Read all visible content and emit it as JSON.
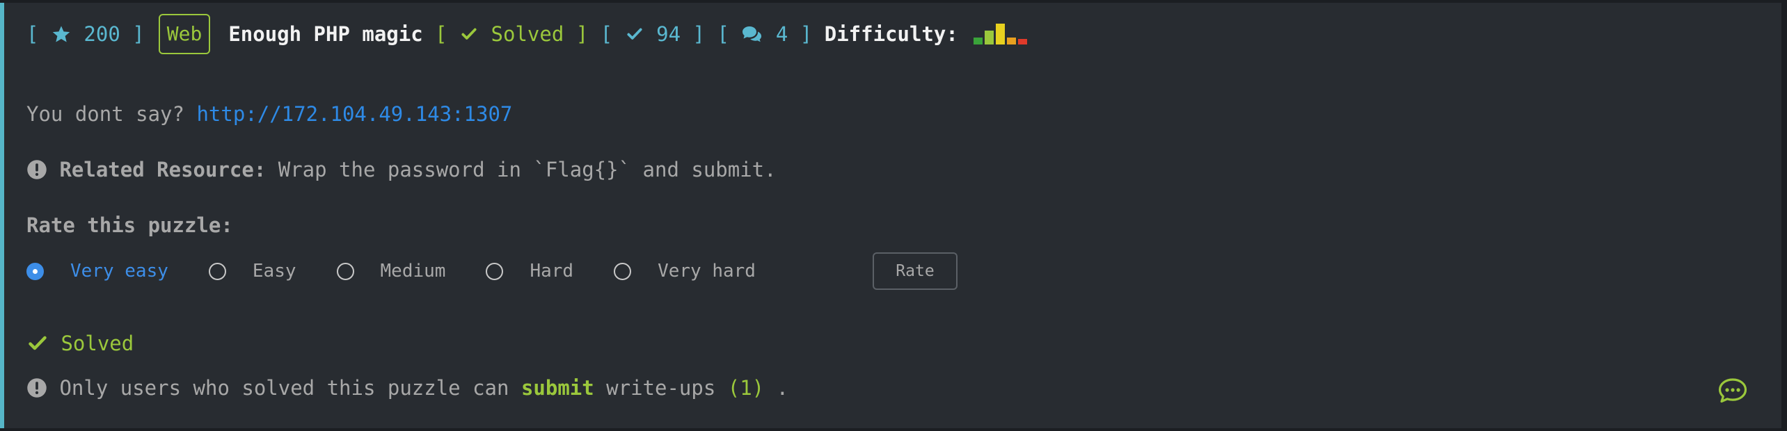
{
  "header": {
    "bracket_open": "[",
    "bracket_close": "]",
    "points": "200",
    "category": "Web",
    "title": "Enough PHP magic",
    "status": "Solved",
    "solves": "94",
    "comments": "4",
    "difficulty_label": "Difficulty:",
    "difficulty_colors": [
      "#3aa33a",
      "#9bc83c",
      "#e8d11f",
      "#e8a01f",
      "#e03a2a"
    ]
  },
  "description": {
    "text": "You dont say? ",
    "link": "http://172.104.49.143:1307"
  },
  "resource": {
    "label": "Related Resource:",
    "text": " Wrap the password in `Flag{}` and submit."
  },
  "rating": {
    "title": "Rate this puzzle:",
    "options": [
      "Very easy",
      "Easy",
      "Medium",
      "Hard",
      "Very hard"
    ],
    "selected": "Very easy",
    "button": "Rate"
  },
  "solved": {
    "label": "Solved"
  },
  "writeups": {
    "prefix": "Only users who solved this puzzle can ",
    "link": "submit",
    "middle": " write-ups ",
    "count": "(1)",
    "suffix": " ."
  },
  "icons": {
    "points": "star-icon",
    "status": "check-icon",
    "solves": "check-icon",
    "comments": "comments-icon",
    "info": "exclamation-circle-icon",
    "chat": "chat-bubble-icon"
  }
}
